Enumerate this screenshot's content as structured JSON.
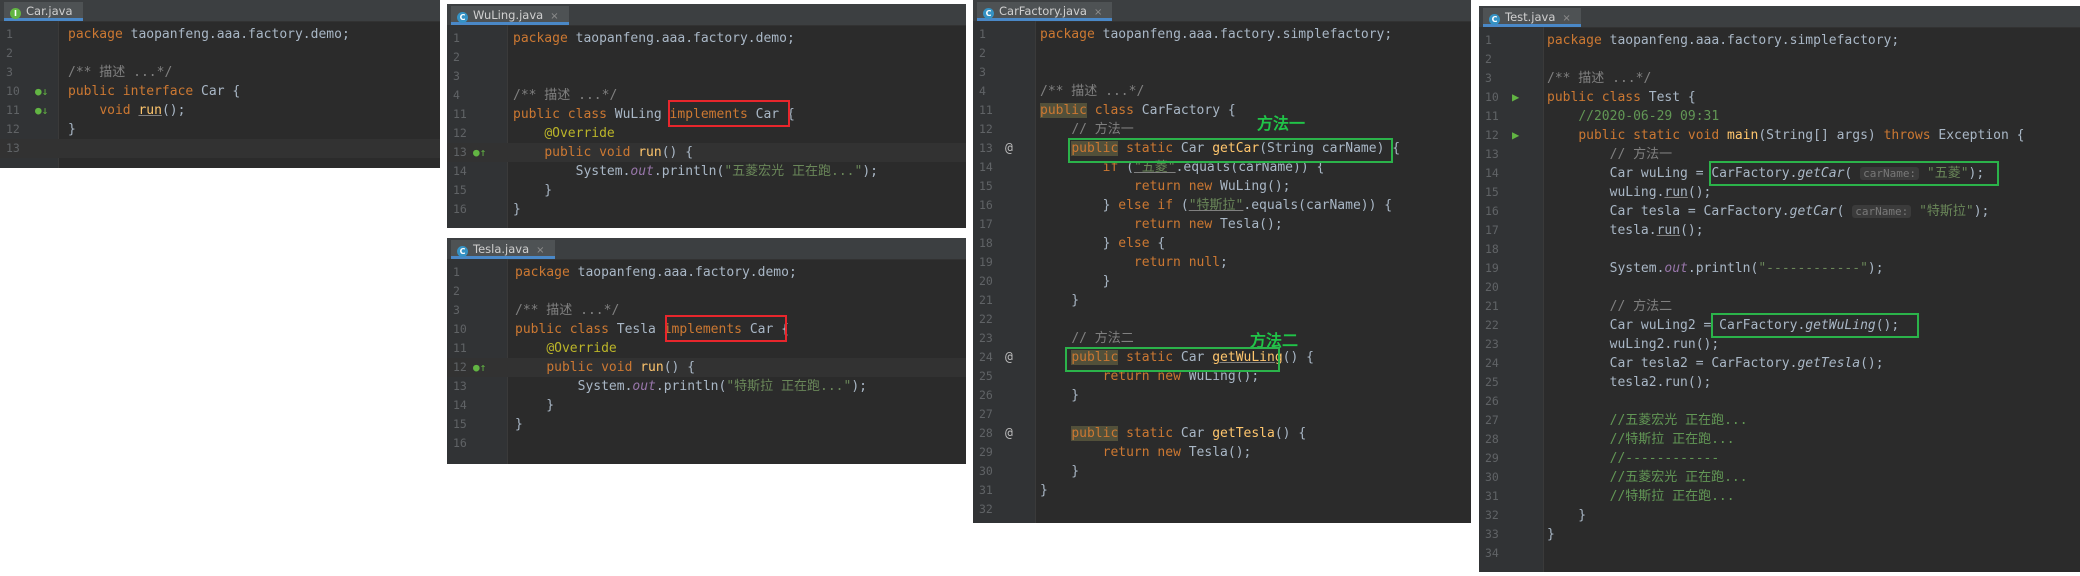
{
  "car": {
    "tab": "Car.java",
    "lines": [
      {
        "n": "1",
        "html": "<span class='kw'>package</span> taopanfeng.aaa.factory.demo;"
      },
      {
        "n": "2",
        "html": ""
      },
      {
        "n": "3",
        "html": "<span class='cm'>/** 描述 ...*/</span>"
      },
      {
        "n": "10",
        "html": "<span class='kw'>public interface</span> Car {"
      },
      {
        "n": "11",
        "html": "    <span class='kw'>void</span> <span class='fn und'>run</span>();"
      },
      {
        "n": "12",
        "html": "}"
      },
      {
        "n": "13",
        "html": ""
      }
    ]
  },
  "wuling": {
    "tab": "WuLing.java",
    "lines": [
      {
        "n": "1",
        "html": "<span class='kw'>package</span> taopanfeng.aaa.factory.demo;"
      },
      {
        "n": "2",
        "html": ""
      },
      {
        "n": "3",
        "html": ""
      },
      {
        "n": "4",
        "html": "<span class='cm'>/** 描述 ...*/</span>"
      },
      {
        "n": "11",
        "html": "<span class='kw'>public class</span> WuLing <span class='kw'>implements</span> Car {"
      },
      {
        "n": "12",
        "html": "    <span class='an'>@Override</span>"
      },
      {
        "n": "13",
        "html": "    <span class='kw'>public void</span> <span class='fn'>run</span>() {"
      },
      {
        "n": "14",
        "html": "        System.<span class='pv'>out</span>.println(<span class='st'>\"五菱宏光 正在跑...\"</span>);"
      },
      {
        "n": "15",
        "html": "    }"
      },
      {
        "n": "16",
        "html": "}"
      }
    ]
  },
  "tesla": {
    "tab": "Tesla.java",
    "lines": [
      {
        "n": "1",
        "html": "<span class='kw'>package</span> taopanfeng.aaa.factory.demo;"
      },
      {
        "n": "2",
        "html": ""
      },
      {
        "n": "3",
        "html": "<span class='cm'>/** 描述 ...*/</span>"
      },
      {
        "n": "10",
        "html": "<span class='kw'>public class</span> Tesla <span class='kw'>implements</span> Car {"
      },
      {
        "n": "11",
        "html": "    <span class='an'>@Override</span>"
      },
      {
        "n": "12",
        "html": "    <span class='kw'>public void</span> <span class='fn'>run</span>() {"
      },
      {
        "n": "13",
        "html": "        System.<span class='pv'>out</span>.println(<span class='st'>\"特斯拉 正在跑...\"</span>);"
      },
      {
        "n": "14",
        "html": "    }"
      },
      {
        "n": "15",
        "html": "}"
      },
      {
        "n": "16",
        "html": ""
      }
    ]
  },
  "factory": {
    "tab": "CarFactory.java",
    "callout1": "方法一",
    "callout2": "方法二",
    "lines": [
      {
        "n": "1",
        "html": "<span class='kw'>package</span> taopanfeng.aaa.factory.simplefactory;"
      },
      {
        "n": "2",
        "html": ""
      },
      {
        "n": "3",
        "html": ""
      },
      {
        "n": "4",
        "html": "<span class='cm'>/** 描述 ...*/</span>"
      },
      {
        "n": "11",
        "html": "<span class='kw pub'>public</span> <span class='kw'>class</span> CarFactory {"
      },
      {
        "n": "12",
        "html": "    <span class='cm'>// 方法一</span>"
      },
      {
        "n": "13",
        "html": "    <span class='kw pub'>public</span> <span class='kw'>static</span> Car <span class='fn'>getCar</span>(String carName) {"
      },
      {
        "n": "14",
        "html": "        <span class='kw'>if</span> (<span class='st und'>\"五菱\"</span>.equals(carName)) {"
      },
      {
        "n": "15",
        "html": "            <span class='kw'>return new</span> WuLing();"
      },
      {
        "n": "16",
        "html": "        } <span class='kw'>else if</span> (<span class='st und'>\"特斯拉\"</span>.equals(carName)) {"
      },
      {
        "n": "17",
        "html": "            <span class='kw'>return new</span> Tesla();"
      },
      {
        "n": "18",
        "html": "        } <span class='kw'>else</span> {"
      },
      {
        "n": "19",
        "html": "            <span class='kw'>return null</span>;"
      },
      {
        "n": "20",
        "html": "        }"
      },
      {
        "n": "21",
        "html": "    }"
      },
      {
        "n": "22",
        "html": ""
      },
      {
        "n": "23",
        "html": "    <span class='cm'>// 方法二</span>"
      },
      {
        "n": "24",
        "html": "    <span class='kw pub'>public</span> <span class='kw'>static</span> Car <span class='fn und'>getWuLing</span>() {"
      },
      {
        "n": "25",
        "html": "        <span class='kw'>return new</span> WuLing();"
      },
      {
        "n": "26",
        "html": "    }"
      },
      {
        "n": "27",
        "html": ""
      },
      {
        "n": "28",
        "html": "    <span class='kw pub'>public</span> <span class='kw'>static</span> Car <span class='fn'>getTesla</span>() {"
      },
      {
        "n": "29",
        "html": "        <span class='kw'>return new</span> Tesla();"
      },
      {
        "n": "30",
        "html": "    }"
      },
      {
        "n": "31",
        "html": "}"
      },
      {
        "n": "32",
        "html": ""
      }
    ]
  },
  "test": {
    "tab": "Test.java",
    "lines": [
      {
        "n": "1",
        "html": "<span class='kw'>package</span> taopanfeng.aaa.factory.simplefactory;"
      },
      {
        "n": "2",
        "html": ""
      },
      {
        "n": "3",
        "html": "<span class='cm'>/** 描述 ...*/</span>"
      },
      {
        "n": "10",
        "html": "<span class='kw'>public class</span> Test {"
      },
      {
        "n": "11",
        "html": "    <span class='gc'>//2020-06-29 09:31</span>"
      },
      {
        "n": "12",
        "html": "    <span class='kw'>public static void</span> <span class='fn'>main</span>(String[] args) <span class='kw'>throws</span> Exception {"
      },
      {
        "n": "13",
        "html": "        <span class='cm'>// 方法一</span>"
      },
      {
        "n": "14",
        "html": "        Car wuLing = CarFactory.<span class='it'>getCar</span>( <span class='hint'>carName:</span> <span class='st'>\"五菱\"</span>);"
      },
      {
        "n": "15",
        "html": "        wuLing.<span class='und'>run</span>();"
      },
      {
        "n": "16",
        "html": "        Car tesla = CarFactory.<span class='it'>getCar</span>( <span class='hint'>carName:</span> <span class='st'>\"特斯拉\"</span>);"
      },
      {
        "n": "17",
        "html": "        tesla.<span class='und'>run</span>();"
      },
      {
        "n": "18",
        "html": ""
      },
      {
        "n": "19",
        "html": "        System.<span class='pv'>out</span>.println(<span class='st'>\"------------\"</span>);"
      },
      {
        "n": "20",
        "html": ""
      },
      {
        "n": "21",
        "html": "        <span class='cm'>// 方法二</span>"
      },
      {
        "n": "22",
        "html": "        Car wuLing2 = CarFactory.<span class='it'>getWuLing</span>();"
      },
      {
        "n": "23",
        "html": "        wuLing2.run();"
      },
      {
        "n": "24",
        "html": "        Car tesla2 = CarFactory.<span class='it'>getTesla</span>();"
      },
      {
        "n": "25",
        "html": "        tesla2.run();"
      },
      {
        "n": "26",
        "html": ""
      },
      {
        "n": "27",
        "html": "        <span class='gc'>//五菱宏光 正在跑...</span>"
      },
      {
        "n": "28",
        "html": "        <span class='gc'>//特斯拉 正在跑...</span>"
      },
      {
        "n": "29",
        "html": "        <span class='gc'>//------------</span>"
      },
      {
        "n": "30",
        "html": "        <span class='gc'>//五菱宏光 正在跑...</span>"
      },
      {
        "n": "31",
        "html": "        <span class='gc'>//特斯拉 正在跑...</span>"
      },
      {
        "n": "32",
        "html": "    }"
      },
      {
        "n": "33",
        "html": "}"
      },
      {
        "n": "34",
        "html": ""
      }
    ]
  }
}
